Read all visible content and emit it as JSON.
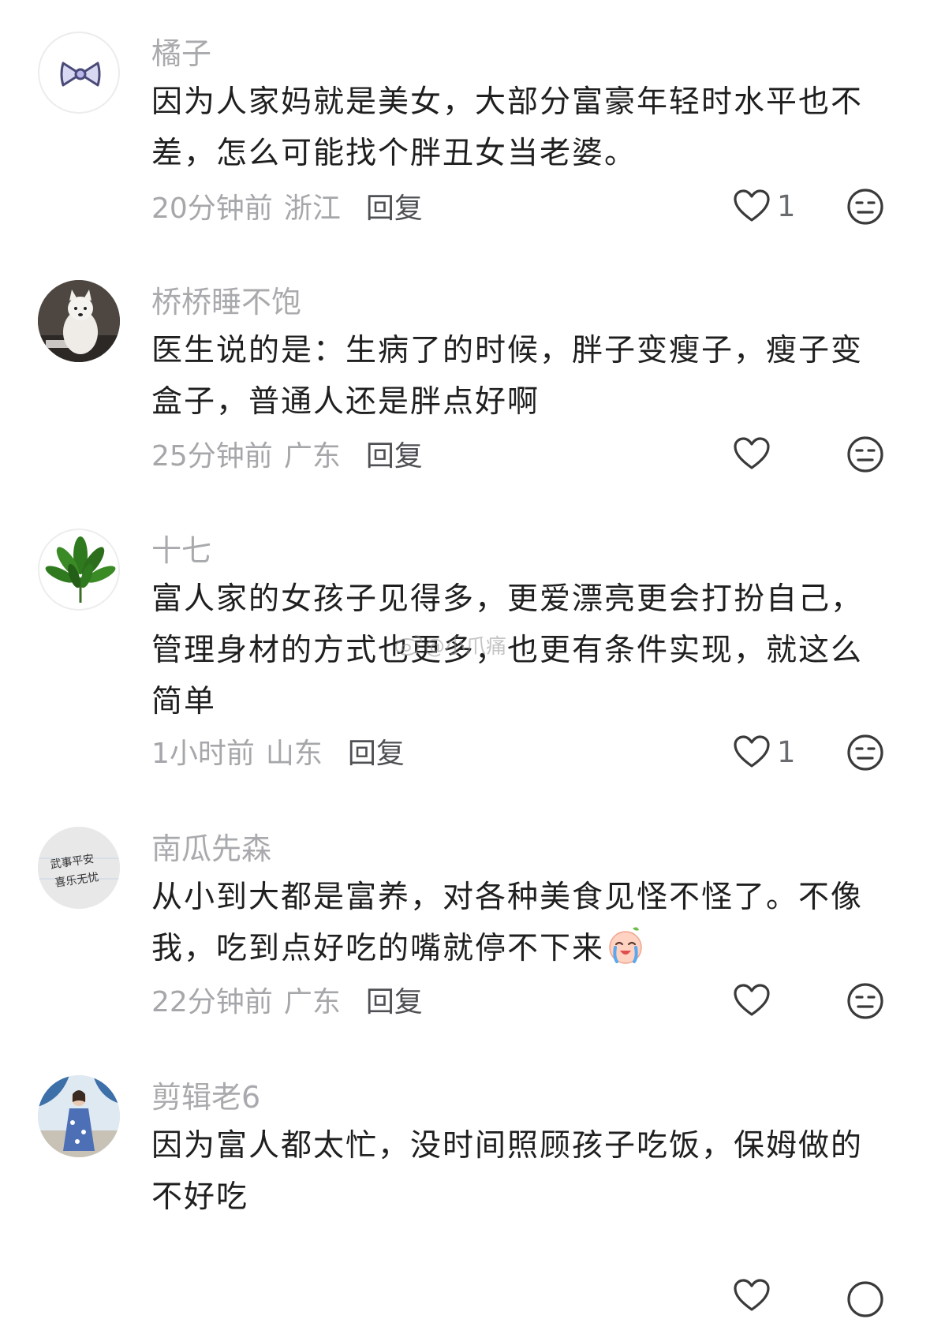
{
  "comments": [
    {
      "username": "橘子",
      "text": "因为人家妈就是美女，大部分富豪年轻时水平也不差，怎么可能找个胖丑女当老婆。",
      "time": "20分钟前",
      "location": "浙江",
      "reply_label": "回复",
      "like_count": "1"
    },
    {
      "username": "桥桥睡不饱",
      "text": "医生说的是：生病了的时候，胖子变瘦子，瘦子变盒子，普通人还是胖点好啊",
      "time": "25分钟前",
      "location": "广东",
      "reply_label": "回复",
      "like_count": ""
    },
    {
      "username": "十七",
      "text": "富人家的女孩子见得多，更爱漂亮更会打扮自己，管理身材的方式也更多，也更有条件实现，就这么简单",
      "time": "1小时前",
      "location": "山东",
      "reply_label": "回复",
      "like_count": "1"
    },
    {
      "username": "南瓜先森",
      "text": "从小到大都是富养，对各种美食见怪不怪了。不像我，吃到点好吃的嘴就停不下来",
      "time": "22分钟前",
      "location": "广东",
      "reply_label": "回复",
      "like_count": ""
    },
    {
      "username": "剪辑老6",
      "text": "因为富人都太忙，没时间照顾孩子吃饭，保姆做的不好吃",
      "time": "",
      "location": "",
      "reply_label": "",
      "like_count": ""
    }
  ],
  "avatar_texts": {
    "comment_4_line1": "武事平安",
    "comment_4_line2": "喜乐无忧"
  },
  "watermark": "@小爪痛",
  "icons": {
    "like": "heart-outline-icon",
    "dislike": "neutral-face-icon",
    "inline_emoji": "crying-face-emoji"
  },
  "colors": {
    "username": "#a9aaad",
    "body_text": "#1f1f1f",
    "meta_text": "#a6a7aa",
    "reply": "#4f5054",
    "icon_stroke": "#3a3a3c"
  }
}
